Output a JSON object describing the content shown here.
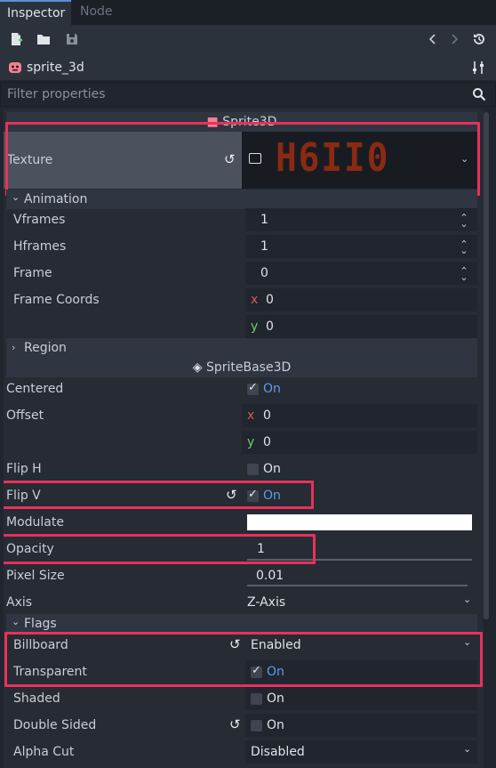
{
  "tabs": [
    {
      "label": "Inspector",
      "active": true
    },
    {
      "label": "Node",
      "active": false
    }
  ],
  "toolbar": {
    "icons": [
      "new-resource-icon",
      "open-resource-icon",
      "save-resource-icon",
      "back-icon",
      "forward-icon",
      "history-icon"
    ]
  },
  "object": {
    "name": "sprite_3d",
    "icon": "sprite-node-icon",
    "settings_icon": "object-settings-icon"
  },
  "filter": {
    "placeholder": "Filter properties",
    "icon": "search-icon"
  },
  "sprite3d": {
    "header": "Sprite3D",
    "texture": {
      "label": "Texture",
      "preview_text": "H6II0"
    },
    "animation": {
      "title": "Animation",
      "vframes": {
        "label": "Vframes",
        "value": "1"
      },
      "hframes": {
        "label": "Hframes",
        "value": "1"
      },
      "frame": {
        "label": "Frame",
        "value": "0"
      },
      "frame_coords": {
        "label": "Frame Coords",
        "x_label": "x",
        "x": "0",
        "y_label": "y",
        "y": "0"
      }
    },
    "region": {
      "title": "Region"
    }
  },
  "spritebase": {
    "header": "SpriteBase3D",
    "centered": {
      "label": "Centered",
      "value": "On",
      "checked": true
    },
    "offset": {
      "label": "Offset",
      "x_label": "x",
      "x": "0",
      "y_label": "y",
      "y": "0"
    },
    "flip_h": {
      "label": "Flip H",
      "value": "On",
      "checked": false
    },
    "flip_v": {
      "label": "Flip V",
      "value": "On",
      "checked": true
    },
    "modulate": {
      "label": "Modulate",
      "color": "#ffffff"
    },
    "opacity": {
      "label": "Opacity",
      "value": "1"
    },
    "pixel_size": {
      "label": "Pixel Size",
      "value": "0.01"
    },
    "axis": {
      "label": "Axis",
      "value": "Z-Axis"
    },
    "flags": {
      "title": "Flags",
      "billboard": {
        "label": "Billboard",
        "value": "Enabled"
      },
      "transparent": {
        "label": "Transparent",
        "value": "On",
        "checked": true
      },
      "shaded": {
        "label": "Shaded",
        "value": "On",
        "checked": false
      },
      "double_sided": {
        "label": "Double Sided",
        "value": "On",
        "checked": false
      },
      "alpha_cut": {
        "label": "Alpha Cut",
        "value": "Disabled"
      }
    }
  },
  "colors": {
    "highlight": "#e8315a",
    "on_text": "#5c9ef0",
    "accent": "#5c8fd6",
    "texture_preview": "#8a2a12"
  }
}
